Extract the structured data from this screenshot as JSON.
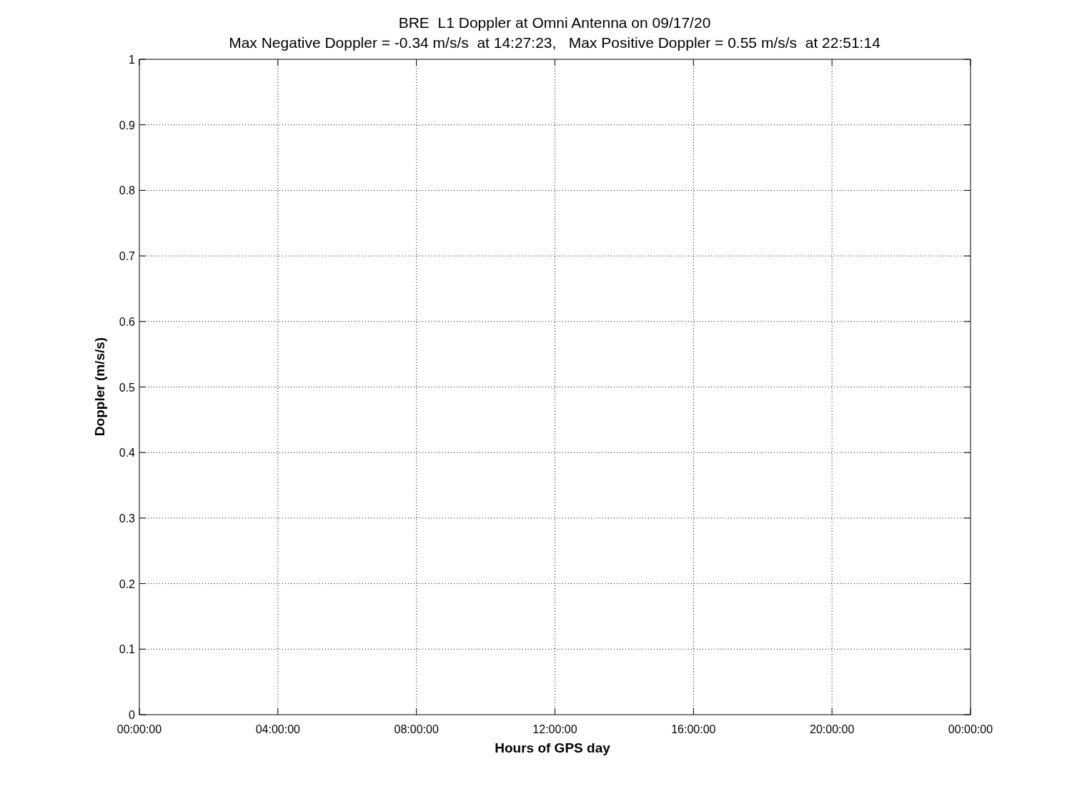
{
  "figure": {
    "subtitle": "Max Negative Doppler = -0.34 m/s/s  at 14:27:23,   Max Positive Doppler = 0.55 m/s/s  at 22:51:14",
    "chart_data": {
      "type": "line",
      "grid": true,
      "title": "BRE  L1 Doppler at Omni Antenna on 09/17/20",
      "xlabel": "Hours of GPS day",
      "ylabel": "Doppler (m/s/s)",
      "ylim": [
        0,
        1
      ],
      "categories": [
        "00:00:00",
        "04:00:00",
        "08:00:00",
        "12:00:00",
        "16:00:00",
        "20:00:00",
        "00:00:00"
      ],
      "yticks": [
        0,
        0.1,
        0.2,
        0.3,
        0.4,
        0.5,
        0.6,
        0.7,
        0.8,
        0.9,
        1
      ]
    }
  }
}
